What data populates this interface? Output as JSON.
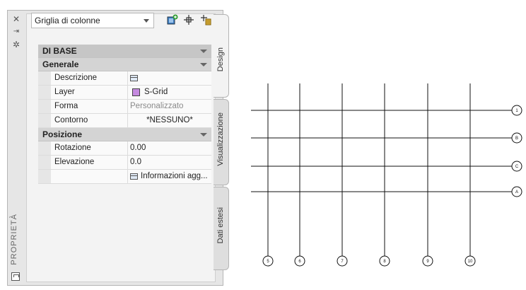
{
  "palette": {
    "title": "PROPRIETÀ",
    "controls": {
      "close": "✕",
      "autohide": "⇥",
      "settings": "✲"
    },
    "tabs": [
      "Design",
      "Visualizzazione",
      "Dati estesi"
    ],
    "selector": {
      "value": "Griglia di colonne"
    },
    "toolbar": [
      "add-style-icon",
      "pick-point-icon",
      "quick-select-icon"
    ],
    "groups": {
      "top": "DI BASE",
      "general": "Generale",
      "position": "Posizione"
    },
    "general_rows": [
      {
        "key": "Descrizione",
        "value": ""
      },
      {
        "key": "Layer",
        "value": "S-Grid",
        "swatch": "#c58ae0"
      },
      {
        "key": "Forma",
        "value": "Personalizzato"
      },
      {
        "key": "Contorno",
        "value": "*NESSUNO*"
      }
    ],
    "position_rows": [
      {
        "key": "Rotazione",
        "value": "0.00"
      },
      {
        "key": "Elevazione",
        "value": "0.0"
      },
      {
        "key": "",
        "value": "Informazioni  agg..."
      }
    ]
  },
  "drawing": {
    "row_labels": [
      "1",
      "B",
      "C",
      "A"
    ],
    "column_labels": [
      "5",
      "6",
      "7",
      "8",
      "9",
      "10"
    ]
  }
}
